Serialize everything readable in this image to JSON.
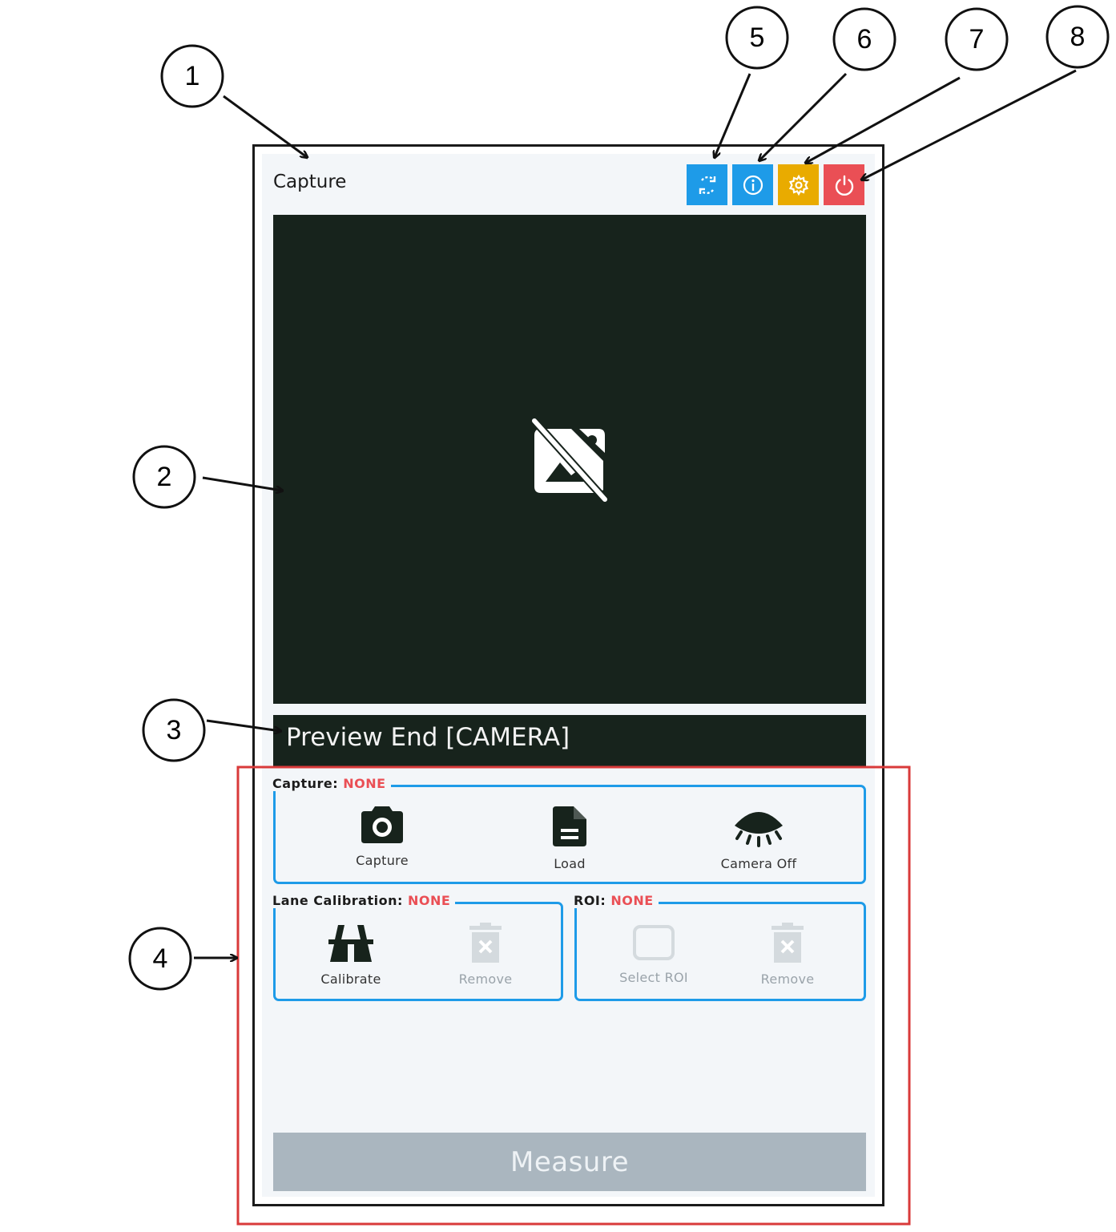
{
  "callouts": [
    "1",
    "2",
    "3",
    "4",
    "5",
    "6",
    "7",
    "8"
  ],
  "window": {
    "title": "Capture"
  },
  "toolbar": {
    "buttons": [
      {
        "name": "refresh-button",
        "icon": "refresh-icon",
        "color": "#1e9be8"
      },
      {
        "name": "info-button",
        "icon": "info-icon",
        "color": "#1e9be8"
      },
      {
        "name": "settings-button",
        "icon": "gear-icon",
        "color": "#e9ab00"
      },
      {
        "name": "power-button",
        "icon": "power-icon",
        "color": "#ea4f55"
      }
    ]
  },
  "preview": {
    "icon": "no-image-icon",
    "background": "#17231c"
  },
  "status": {
    "text": "Preview End [CAMERA]"
  },
  "capture_group": {
    "label": "Capture:",
    "state": "NONE",
    "items": [
      {
        "label": "Capture",
        "icon": "camera-icon",
        "enabled": true
      },
      {
        "label": "Load",
        "icon": "file-icon",
        "enabled": true
      },
      {
        "label": "Camera Off",
        "icon": "eye-closed-icon",
        "enabled": true
      }
    ]
  },
  "lane_group": {
    "label": "Lane Calibration:",
    "state": "NONE",
    "items": [
      {
        "label": "Calibrate",
        "icon": "road-icon",
        "enabled": true
      },
      {
        "label": "Remove",
        "icon": "trash-icon",
        "enabled": false
      }
    ]
  },
  "roi_group": {
    "label": "ROI:",
    "state": "NONE",
    "items": [
      {
        "label": "Select ROI",
        "icon": "rectangle-icon",
        "enabled": false
      },
      {
        "label": "Remove",
        "icon": "trash-icon",
        "enabled": false
      }
    ]
  },
  "measure": {
    "label": "Measure",
    "enabled": false
  },
  "colors": {
    "accent": "#1e9be8",
    "warning": "#e9ab00",
    "danger": "#ea4f55",
    "dark": "#17231c",
    "disabled": "#aab6bf",
    "annotation": "#d93a3a"
  }
}
